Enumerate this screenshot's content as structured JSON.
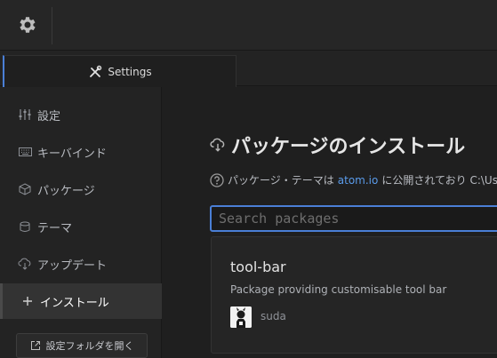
{
  "tab": {
    "label": "Settings",
    "icon": "tools-icon"
  },
  "sidebar": {
    "items": [
      {
        "label": "設定",
        "icon": "sliders-icon"
      },
      {
        "label": "キーバインド",
        "icon": "keyboard-icon"
      },
      {
        "label": "パッケージ",
        "icon": "package-icon"
      },
      {
        "label": "テーマ",
        "icon": "paintcan-icon"
      },
      {
        "label": "アップデート",
        "icon": "cloud-download-icon"
      },
      {
        "label": "インストール",
        "icon": "plus-icon"
      }
    ],
    "active_index": 5,
    "open_config_label": "設定フォルダを開く"
  },
  "main": {
    "heading": "パッケージのインストール",
    "info_prefix": "パッケージ・テーマは",
    "info_link": "atom.io",
    "info_suffix": "に公開されており C:\\Use",
    "search_placeholder": "Search packages",
    "package": {
      "name": "tool-bar",
      "description": "Package providing customisable tool bar",
      "author": "suda"
    }
  },
  "colors": {
    "accent": "#4a7fd6",
    "link": "#5a9bea"
  }
}
